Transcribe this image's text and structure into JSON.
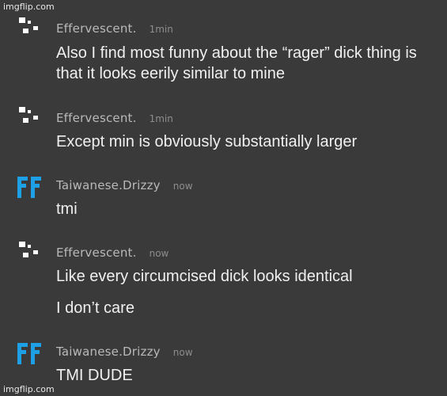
{
  "watermark": "imgflip.com",
  "colors": {
    "background": "#3a3a3a",
    "username": "#b9b9b9",
    "timestamp": "#8e8e8e",
    "message_text": "#f0f0f0",
    "ff_avatar": "#1ea0e6",
    "pixel_avatar": "#ffffff"
  },
  "messages": [
    {
      "avatar": "pixel-blocks-avatar",
      "username": "Effervescent.",
      "time": "1min",
      "lines": [
        "Also I find most funny about the “rager” dick thing is that it looks eerily similar to mine"
      ]
    },
    {
      "avatar": "pixel-blocks-avatar",
      "username": "Effervescent.",
      "time": "1min",
      "lines": [
        "Except min is obviously substantially larger"
      ]
    },
    {
      "avatar": "ff-logo-avatar",
      "username": "Taiwanese.Drizzy",
      "time": "now",
      "lines": [
        "tmi"
      ]
    },
    {
      "avatar": "pixel-blocks-avatar",
      "username": "Effervescent.",
      "time": "now",
      "lines": [
        "Like every circumcised dick looks identical",
        "I don’t care"
      ]
    },
    {
      "avatar": "ff-logo-avatar",
      "username": "Taiwanese.Drizzy",
      "time": "now",
      "lines": [
        "TMI DUDE"
      ]
    }
  ]
}
